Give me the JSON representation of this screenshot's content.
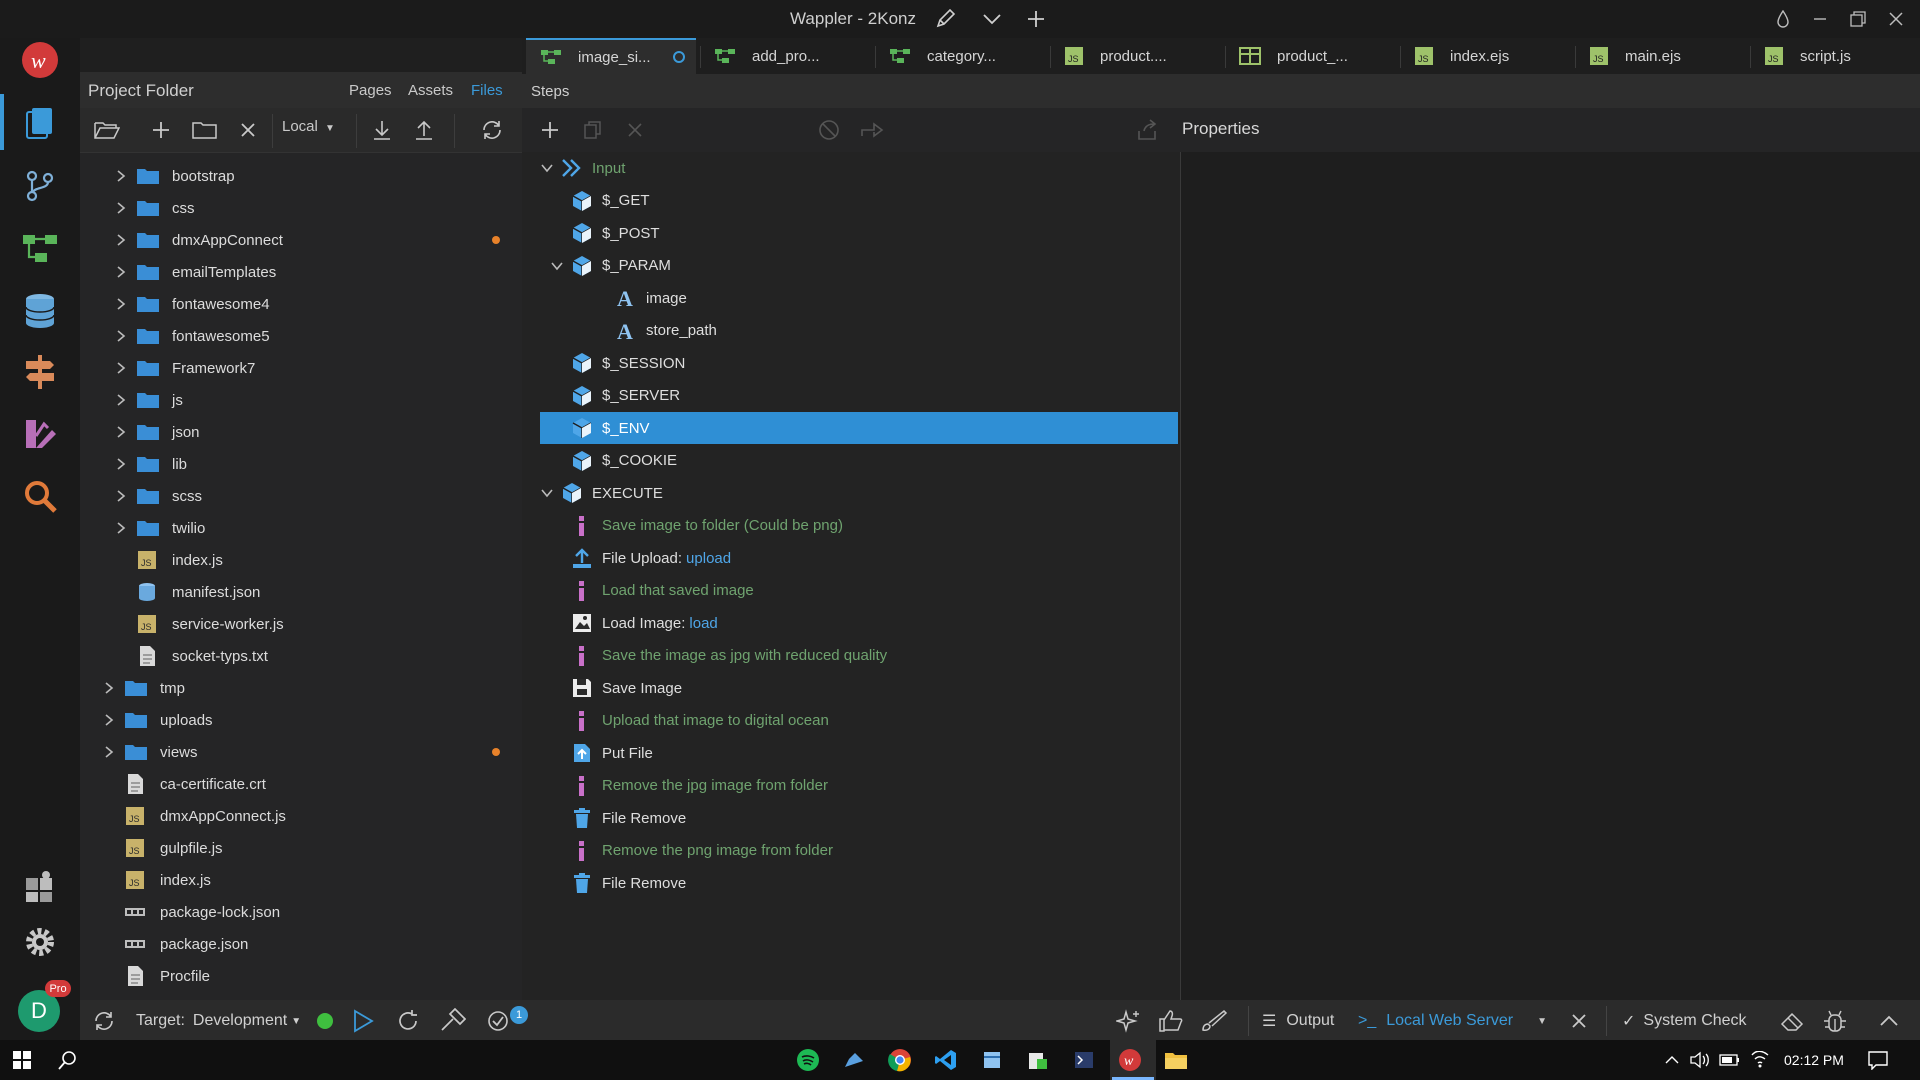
{
  "window": {
    "title": "Wappler - 2Konz"
  },
  "colors": {
    "accent": "#3b9ad9",
    "selection": "#2f8fd5",
    "comment": "#6fa36f",
    "modified_dot": "#e8822a",
    "status_green": "#3fbf3f"
  },
  "editor_tabs": [
    {
      "label": "image_si...",
      "icon": "server-action-icon",
      "active": true,
      "unsaved": true
    },
    {
      "label": "add_pro...",
      "icon": "server-action-icon"
    },
    {
      "label": "category...",
      "icon": "server-action-icon"
    },
    {
      "label": "product....",
      "icon": "js-file-icon"
    },
    {
      "label": "product_...",
      "icon": "table-icon"
    },
    {
      "label": "index.ejs",
      "icon": "js-file-icon"
    },
    {
      "label": "main.ejs",
      "icon": "js-file-icon"
    },
    {
      "label": "script.js",
      "icon": "js-file-icon"
    }
  ],
  "project": {
    "title": "Project Folder",
    "tabs": [
      "Pages",
      "Assets",
      "Files"
    ],
    "active_tab": "Files",
    "location": "Local",
    "tree": [
      {
        "label": "bootstrap",
        "type": "folder",
        "level": 1,
        "expandable": true
      },
      {
        "label": "css",
        "type": "folder",
        "level": 1,
        "expandable": true
      },
      {
        "label": "dmxAppConnect",
        "type": "folder",
        "level": 1,
        "expandable": true,
        "modified": true
      },
      {
        "label": "emailTemplates",
        "type": "folder",
        "level": 1,
        "expandable": true
      },
      {
        "label": "fontawesome4",
        "type": "folder",
        "level": 1,
        "expandable": true
      },
      {
        "label": "fontawesome5",
        "type": "folder",
        "level": 1,
        "expandable": true
      },
      {
        "label": "Framework7",
        "type": "folder",
        "level": 1,
        "expandable": true
      },
      {
        "label": "js",
        "type": "folder",
        "level": 1,
        "expandable": true
      },
      {
        "label": "json",
        "type": "folder",
        "level": 1,
        "expandable": true
      },
      {
        "label": "lib",
        "type": "folder",
        "level": 1,
        "expandable": true
      },
      {
        "label": "scss",
        "type": "folder",
        "level": 1,
        "expandable": true
      },
      {
        "label": "twilio",
        "type": "folder",
        "level": 1,
        "expandable": true
      },
      {
        "label": "index.js",
        "type": "js",
        "level": 1
      },
      {
        "label": "manifest.json",
        "type": "db",
        "level": 1
      },
      {
        "label": "service-worker.js",
        "type": "js",
        "level": 1
      },
      {
        "label": "socket-typs.txt",
        "type": "txt",
        "level": 1
      },
      {
        "label": "tmp",
        "type": "folder",
        "level": 0,
        "expandable": true
      },
      {
        "label": "uploads",
        "type": "folder",
        "level": 0,
        "expandable": true
      },
      {
        "label": "views",
        "type": "folder",
        "level": 0,
        "expandable": true,
        "modified": true
      },
      {
        "label": "ca-certificate.crt",
        "type": "txt",
        "level": 0
      },
      {
        "label": "dmxAppConnect.js",
        "type": "js",
        "level": 0
      },
      {
        "label": "gulpfile.js",
        "type": "js",
        "level": 0
      },
      {
        "label": "index.js",
        "type": "js",
        "level": 0
      },
      {
        "label": "package-lock.json",
        "type": "npm",
        "level": 0
      },
      {
        "label": "package.json",
        "type": "npm",
        "level": 0
      },
      {
        "label": "Procfile",
        "type": "txt",
        "level": 0
      }
    ]
  },
  "steps": {
    "title": "Steps",
    "properties_title": "Properties",
    "items": [
      {
        "label": "Input",
        "icon": "input-icon",
        "level": 0,
        "expanded": true,
        "style": "green"
      },
      {
        "label": "$_GET",
        "icon": "cube-icon",
        "level": 1
      },
      {
        "label": "$_POST",
        "icon": "cube-icon",
        "level": 1
      },
      {
        "label": "$_PARAM",
        "icon": "cube-icon",
        "level": 1,
        "expanded": true
      },
      {
        "label": "image",
        "icon": "text-var-icon",
        "level": 2
      },
      {
        "label": "store_path",
        "icon": "text-var-icon",
        "level": 2
      },
      {
        "label": "$_SESSION",
        "icon": "cube-icon",
        "level": 1
      },
      {
        "label": "$_SERVER",
        "icon": "cube-icon",
        "level": 1
      },
      {
        "label": "$_ENV",
        "icon": "cube-icon",
        "level": 1,
        "selected": true
      },
      {
        "label": "$_COOKIE",
        "icon": "cube-icon",
        "level": 1
      },
      {
        "label": "EXECUTE",
        "icon": "cube-icon",
        "level": 0,
        "expanded": true
      },
      {
        "label": "Save image to folder (Could be png)",
        "icon": "comment-icon",
        "level": 1,
        "style": "comment"
      },
      {
        "label": "File Upload: ",
        "value": "upload",
        "icon": "upload-icon",
        "level": 1
      },
      {
        "label": "Load that saved image",
        "icon": "comment-icon",
        "level": 1,
        "style": "comment"
      },
      {
        "label": "Load Image: ",
        "value": "load",
        "icon": "image-icon",
        "level": 1
      },
      {
        "label": "Save the image as jpg with reduced quality",
        "icon": "comment-icon",
        "level": 1,
        "style": "comment"
      },
      {
        "label": "Save Image",
        "icon": "save-icon",
        "level": 1
      },
      {
        "label": "Upload that image to digital ocean",
        "icon": "comment-icon",
        "level": 1,
        "style": "comment"
      },
      {
        "label": "Put File",
        "icon": "put-file-icon",
        "level": 1
      },
      {
        "label": "Remove the jpg image from folder",
        "icon": "comment-icon",
        "level": 1,
        "style": "comment"
      },
      {
        "label": "File Remove",
        "icon": "trash-icon",
        "level": 1
      },
      {
        "label": "Remove the png image from folder",
        "icon": "comment-icon",
        "level": 1,
        "style": "comment"
      },
      {
        "label": "File Remove",
        "icon": "trash-icon",
        "level": 1
      }
    ]
  },
  "statusbar": {
    "target_label": "Target:",
    "target_value": "Development",
    "badge_count": "1",
    "output_label": "Output",
    "server_label": "Local Web Server",
    "system_check_label": "System Check"
  },
  "user": {
    "initial": "D",
    "badge": "Pro"
  },
  "taskbar": {
    "time": "02:12 PM"
  }
}
